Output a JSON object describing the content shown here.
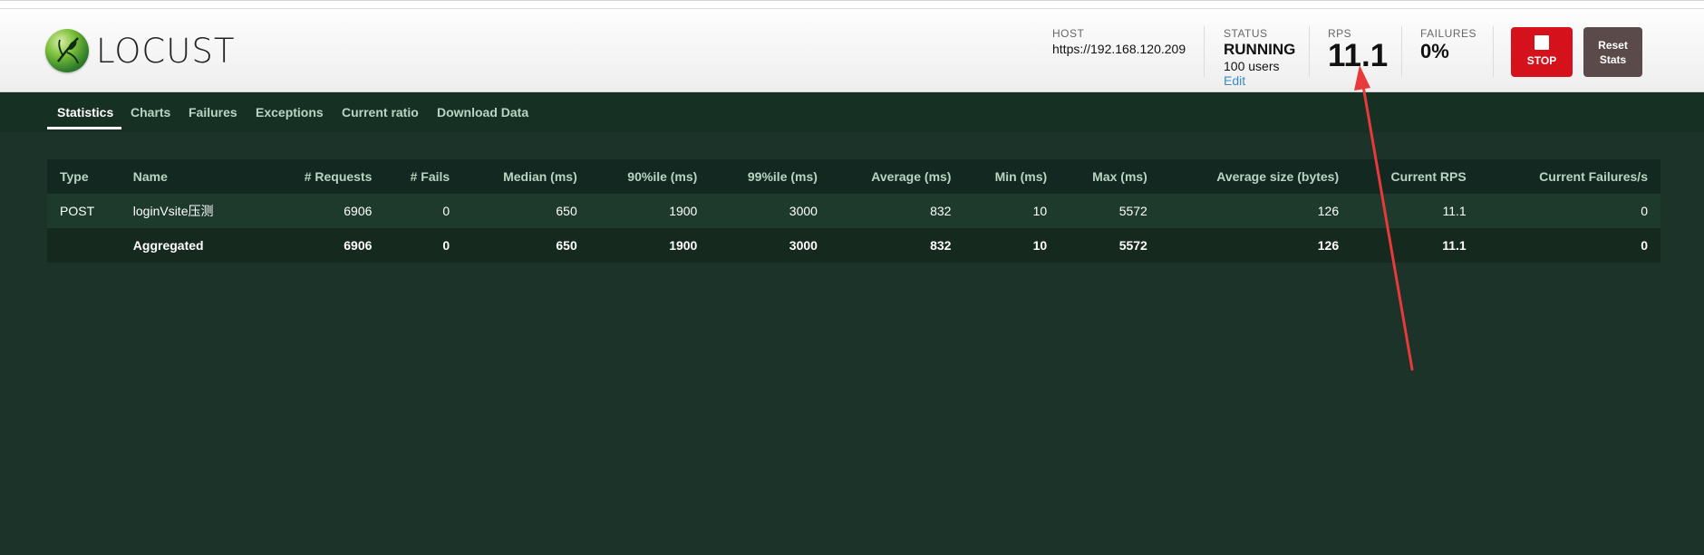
{
  "brand": {
    "name": "LOCUST"
  },
  "header": {
    "host": {
      "label": "HOST",
      "value": "https://192.168.120.209"
    },
    "status": {
      "label": "STATUS",
      "value": "RUNNING",
      "users": "100 users",
      "edit": "Edit"
    },
    "rps": {
      "label": "RPS",
      "value": "11.1"
    },
    "failures": {
      "label": "FAILURES",
      "value": "0%"
    },
    "stop_label": "STOP",
    "reset_label_1": "Reset",
    "reset_label_2": "Stats"
  },
  "tabs": [
    {
      "label": "Statistics",
      "active": true
    },
    {
      "label": "Charts"
    },
    {
      "label": "Failures"
    },
    {
      "label": "Exceptions"
    },
    {
      "label": "Current ratio"
    },
    {
      "label": "Download Data"
    }
  ],
  "table": {
    "headers": [
      "Type",
      "Name",
      "# Requests",
      "# Fails",
      "Median (ms)",
      "90%ile (ms)",
      "99%ile (ms)",
      "Average (ms)",
      "Min (ms)",
      "Max (ms)",
      "Average size (bytes)",
      "Current RPS",
      "Current Failures/s"
    ],
    "rows": [
      [
        "POST",
        "loginVsite压测",
        "6906",
        "0",
        "650",
        "1900",
        "3000",
        "832",
        "10",
        "5572",
        "126",
        "11.1",
        "0"
      ]
    ],
    "aggregate": [
      "",
      "Aggregated",
      "6906",
      "0",
      "650",
      "1900",
      "3000",
      "832",
      "10",
      "5572",
      "126",
      "11.1",
      "0"
    ]
  },
  "colors": {
    "background": "#1b3328",
    "tabbar": "#173024",
    "stop": "#d5121b",
    "reset": "#5b4a4a",
    "annotation": "#e8393b"
  }
}
